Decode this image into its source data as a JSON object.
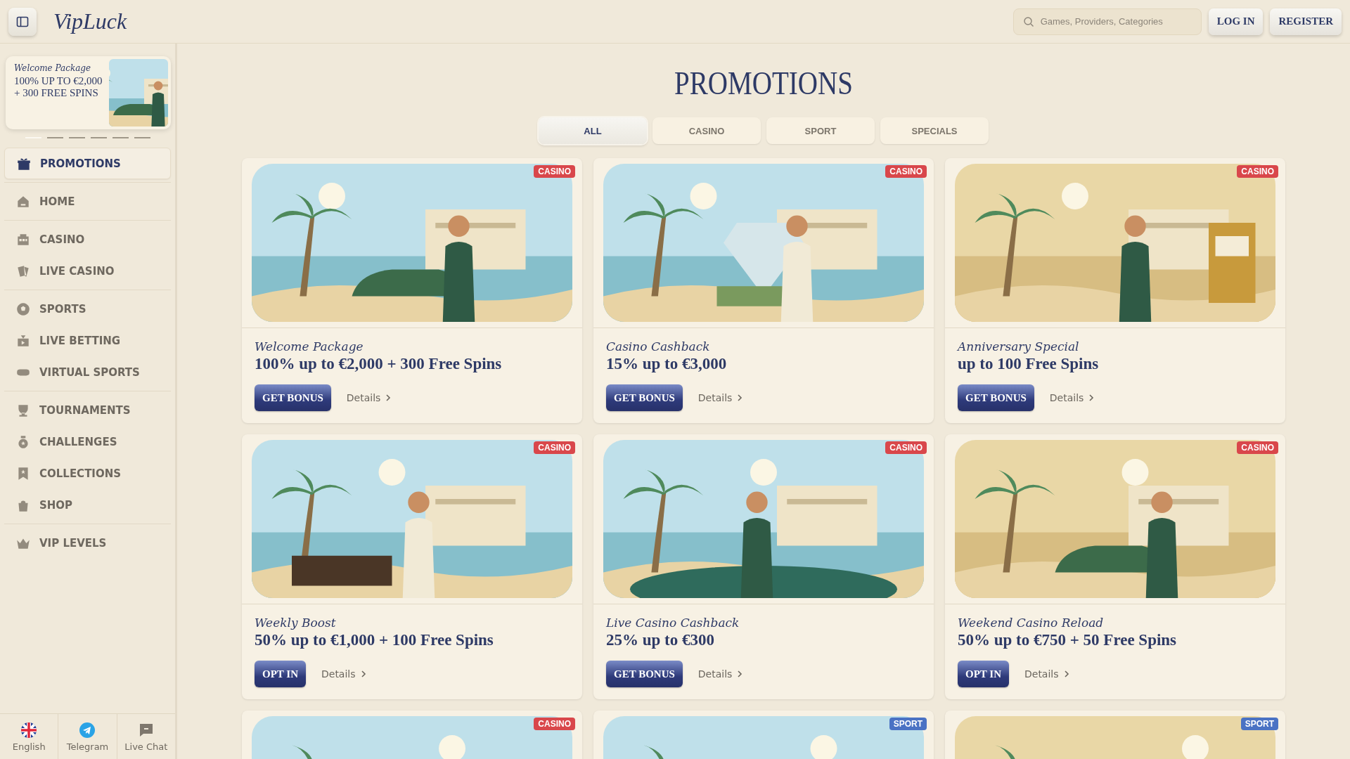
{
  "header": {
    "logo": "VipLuck",
    "search": {
      "placeholder": "Games, Providers, Categories"
    },
    "buttons": [
      "LOG IN",
      "REGISTER"
    ]
  },
  "sidebar": {
    "banner": {
      "script": "Welcome Package",
      "title": "100% UP TO €2,000 + 300 FREE SPINS",
      "kind": "picture"
    },
    "dots": [
      {
        "selected": true
      },
      {
        "selected": false
      },
      {
        "selected": false
      },
      {
        "selected": false
      },
      {
        "selected": false
      },
      {
        "selected": false
      }
    ],
    "groups": [
      [
        {
          "label": "PROMOTIONS",
          "selected": true
        }
      ],
      [
        {
          "label": "HOME",
          "selected": false
        }
      ],
      [
        {
          "label": "CASINO",
          "selected": false
        },
        {
          "label": "LIVE CASINO",
          "selected": false
        }
      ],
      [
        {
          "label": "SPORTS",
          "selected": false
        },
        {
          "label": "LIVE BETTING",
          "selected": false
        },
        {
          "label": "VIRTUAL SPORTS",
          "selected": false
        }
      ],
      [
        {
          "label": "TOURNAMENTS",
          "selected": false
        },
        {
          "label": "CHALLENGES",
          "selected": false
        },
        {
          "label": "COLLECTIONS",
          "selected": false
        },
        {
          "label": "SHOP",
          "selected": false
        }
      ],
      [
        {
          "label": "VIP LEVELS",
          "selected": false
        }
      ]
    ],
    "footer": [
      "English",
      "Telegram",
      "Live Chat"
    ]
  },
  "page": {
    "title": "PROMOTIONS",
    "tabs": [
      {
        "label": "ALL",
        "selected": true
      },
      {
        "label": "CASINO",
        "selected": false
      },
      {
        "label": "SPORT",
        "selected": false
      },
      {
        "label": "SPECIALS",
        "selected": false
      }
    ],
    "cards": [
      {
        "tag": "CASINO",
        "color": "#d9474b",
        "kind": "picture",
        "subtitle": "Welcome Package",
        "title": "100% up to €2,000 + 300 Free Spins",
        "button": "GET BONUS",
        "details": "Details"
      },
      {
        "tag": "CASINO",
        "color": "#d9474b",
        "kind": "picture",
        "subtitle": "Casino Cashback",
        "title": "15% up to €3,000",
        "button": "GET BONUS",
        "details": "Details"
      },
      {
        "tag": "CASINO",
        "color": "#d9474b",
        "kind": "picture",
        "subtitle": "Anniversary Special",
        "title": "up to 100 Free Spins",
        "button": "GET BONUS",
        "details": "Details"
      },
      {
        "tag": "CASINO",
        "color": "#d9474b",
        "kind": "picture",
        "subtitle": "Weekly Boost",
        "title": "50% up to €1,000 + 100 Free Spins",
        "button": "OPT IN",
        "details": "Details"
      },
      {
        "tag": "CASINO",
        "color": "#d9474b",
        "kind": "picture",
        "subtitle": "Live Casino Cashback",
        "title": "25% up to €300",
        "button": "GET BONUS",
        "details": "Details"
      },
      {
        "tag": "CASINO",
        "color": "#d9474b",
        "kind": "picture",
        "subtitle": "Weekend Casino Reload",
        "title": "50% up to €750 + 50 Free Spins",
        "button": "OPT IN",
        "details": "Details"
      },
      {
        "tag": "CASINO",
        "color": "#d9474b",
        "kind": "picture"
      },
      {
        "tag": "SPORT",
        "color": "#4a72c4",
        "kind": "picture"
      },
      {
        "tag": "SPORT",
        "color": "#4a72c4",
        "kind": "picture"
      }
    ]
  }
}
